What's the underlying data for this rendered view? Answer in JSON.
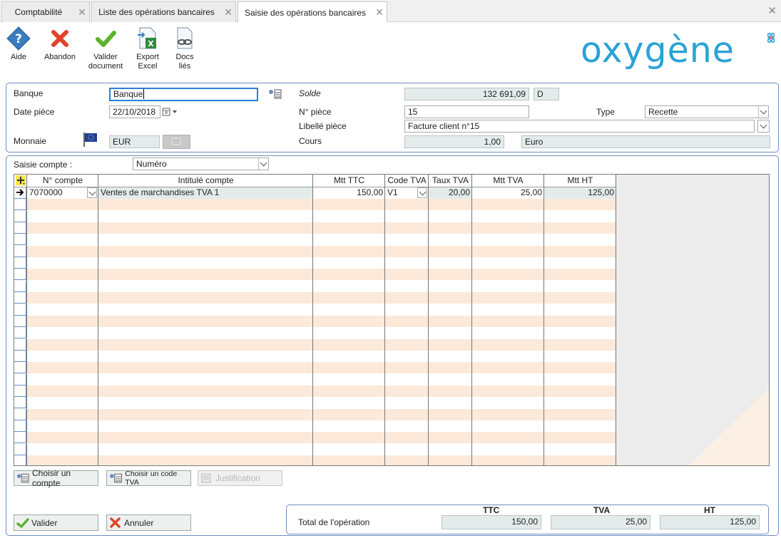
{
  "tabs": [
    {
      "label": "Comptabilité"
    },
    {
      "label": "Liste des opérations bancaires"
    },
    {
      "label": "Saisie des opérations bancaires"
    }
  ],
  "toolbar": {
    "aide": "Aide",
    "abandon": "Abandon",
    "valider": "Valider document",
    "export": "Export Excel",
    "docs": "Docs liés"
  },
  "brand": {
    "name": "oxygène",
    "color": "#29a3d6"
  },
  "header": {
    "banque_label": "Banque",
    "banque_value": "Banque",
    "date_label": "Date pièce",
    "date_value": "22/10/2018",
    "monnaie_label": "Monnaie",
    "monnaie_value": "EUR",
    "solde_label": "Solde",
    "solde_value": "132 691,09",
    "solde_sens": "D",
    "npiece_label": "N° pièce",
    "npiece_value": "15",
    "type_label": "Type",
    "type_value": "Recette",
    "libelle_label": "Libellé pièce",
    "libelle_value": "Facture client n°15",
    "cours_label": "Cours",
    "cours_value": "1,00",
    "cours_devise": "Euro"
  },
  "saisie": {
    "label": "Saisie compte :",
    "value": "Numéro"
  },
  "grid": {
    "columns": [
      "N° compte",
      "Intitulé compte",
      "Mtt TTC",
      "Code TVA",
      "Taux TVA",
      "Mtt TVA",
      "Mtt HT"
    ],
    "rows": [
      {
        "compte": "7070000",
        "intitule": "Ventes de marchandises TVA 1",
        "ttc": "150,00",
        "code_tva": "V1",
        "taux": "20,00",
        "tva": "25,00",
        "ht": "125,00"
      }
    ]
  },
  "actions": {
    "choisir_compte": "Choisir un compte",
    "choisir_tva": "Choisir un code TVA",
    "justification": "Justification",
    "valider": "Valider",
    "annuler": "Annuler"
  },
  "totals": {
    "label": "Total de l'opération",
    "ttc_label": "TTC",
    "tva_label": "TVA",
    "ht_label": "HT",
    "ttc": "150,00",
    "tva": "25,00",
    "ht": "125,00"
  }
}
